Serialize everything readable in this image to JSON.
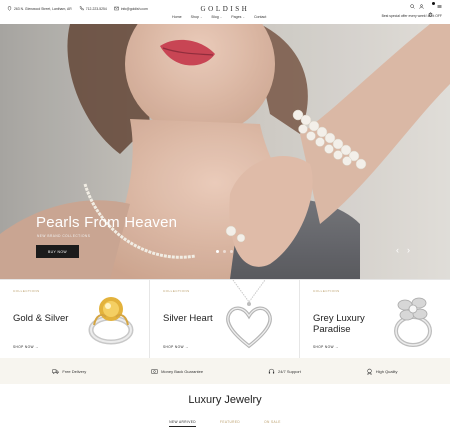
{
  "topbar": {
    "address": "263 N. Glenwood Street, Lantham, AR",
    "phone": "712-223-5254",
    "email": "info@goldish.com",
    "promo": "Best special offer every week! 40% OFF"
  },
  "brand": {
    "logo": "GOLDISH"
  },
  "nav": {
    "items": [
      {
        "label": "Home",
        "has_dropdown": false
      },
      {
        "label": "Shop",
        "has_dropdown": true
      },
      {
        "label": "Blog",
        "has_dropdown": true
      },
      {
        "label": "Pages",
        "has_dropdown": true
      },
      {
        "label": "Contact",
        "has_dropdown": false
      }
    ],
    "chevron": "⌄"
  },
  "utility_icons": [
    "search-icon",
    "user-icon",
    "cart-icon",
    "menu-icon"
  ],
  "hero": {
    "title": "Pearls From Heaven",
    "subtitle": "NEW BRAND COLLECTIONS",
    "button": "BUY NOW",
    "prev": "‹",
    "next": "›",
    "slides": 3,
    "active_slide": 1
  },
  "collections": [
    {
      "eyebrow": "COLLECTIONS",
      "title": "Gold & Silver",
      "cta": "SHOP NOW →"
    },
    {
      "eyebrow": "COLLECTIONS",
      "title": "Silver Heart",
      "cta": "SHOP NOW →"
    },
    {
      "eyebrow": "COLLECTIONS",
      "title": "Grey Luxury Paradise",
      "cta": "SHOP NOW →"
    }
  ],
  "features": [
    {
      "icon": "truck-icon",
      "label": "Free Delivery"
    },
    {
      "icon": "money-back-icon",
      "label": "Money Back Guarantee"
    },
    {
      "icon": "support-icon",
      "label": "24/7 Support"
    },
    {
      "icon": "quality-icon",
      "label": "High Quality"
    }
  ],
  "section": {
    "title": "Luxury Jewelry",
    "tabs": [
      "NEW ARRIVED",
      "FEATURED",
      "ON SALE"
    ],
    "active_tab": 0
  },
  "colors": {
    "accent": "#b89b65",
    "dark": "#1b1b1b",
    "feature_bg": "#f7f5ef"
  }
}
